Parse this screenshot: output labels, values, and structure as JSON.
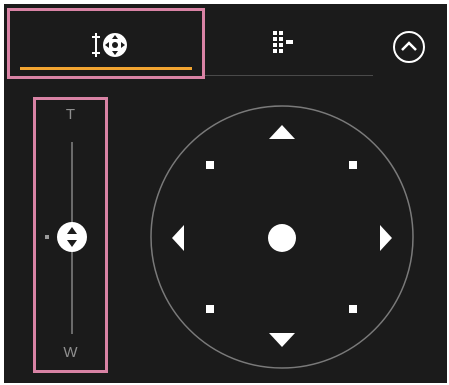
{
  "tabs": [
    {
      "icon": "pan-tilt-zoom-icon",
      "active": true
    },
    {
      "icon": "preset-grid-icon",
      "active": false
    }
  ],
  "collapse": {
    "icon": "chevron-up-circle-icon"
  },
  "zoom": {
    "top_label": "T",
    "bottom_label": "W",
    "position": 0.5
  },
  "colors": {
    "background": "#1b1b1b",
    "highlight_border": "#d983a5",
    "active_tab_underline": "#f2a531",
    "foreground": "#ffffff"
  },
  "pad": {
    "buttons": [
      "up-arrow",
      "down-arrow",
      "left-arrow",
      "right-arrow",
      "center-dot",
      "up-left",
      "up-right",
      "down-left",
      "down-right"
    ]
  }
}
